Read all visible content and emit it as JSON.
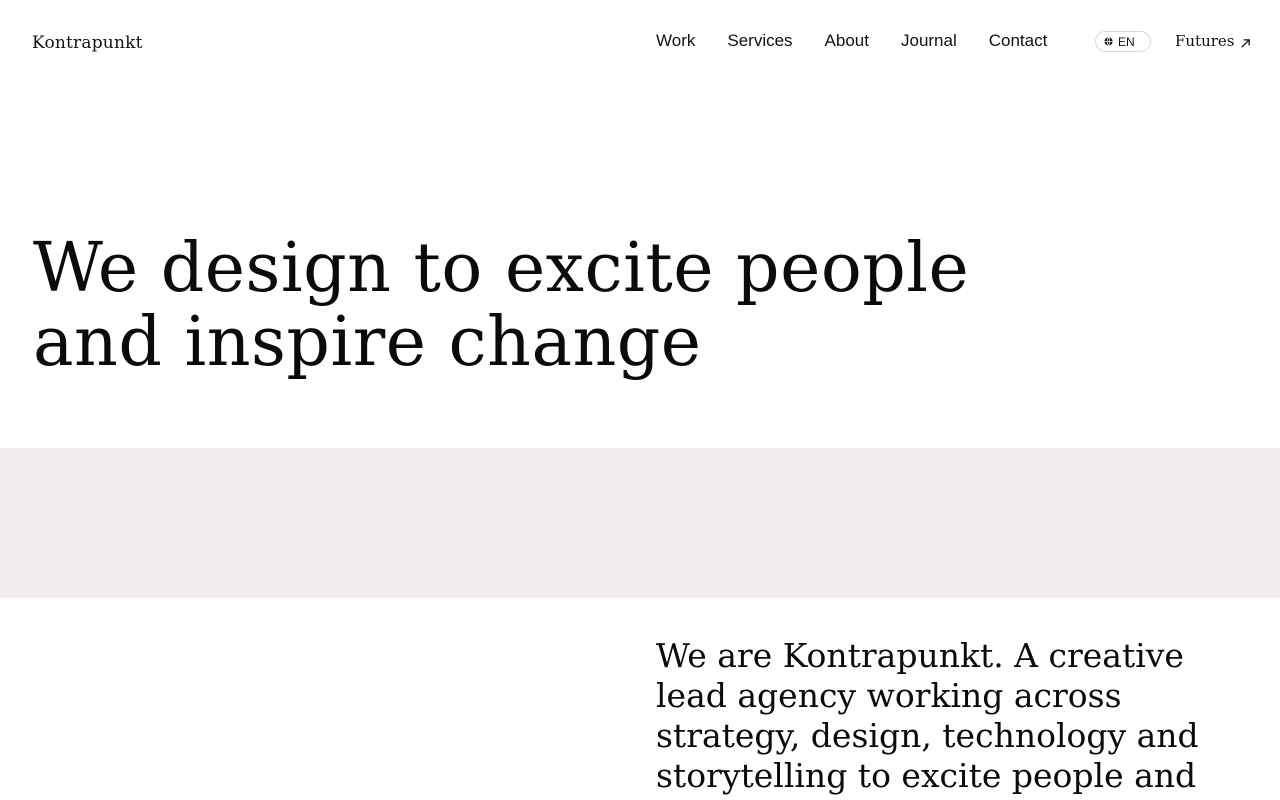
{
  "header": {
    "logo": "Kontrapunkt",
    "nav": [
      {
        "label": "Work"
      },
      {
        "label": "Services"
      },
      {
        "label": "About"
      },
      {
        "label": "Journal"
      },
      {
        "label": "Contact"
      }
    ],
    "language": {
      "label": "EN",
      "icon": "globe-icon"
    },
    "futures": {
      "label": "Futures",
      "icon": "arrow-up-right-icon"
    }
  },
  "hero": {
    "line1": "We design to excite people",
    "line2": "and inspire change"
  },
  "intro": {
    "text": "We are Kontrapunkt. A creative lead agency working across strategy, design, technology and storytelling to excite people and"
  },
  "colors": {
    "background": "#ffffff",
    "text": "#111111",
    "band": "#f2eeed",
    "pill_border": "#d8d8d8"
  }
}
